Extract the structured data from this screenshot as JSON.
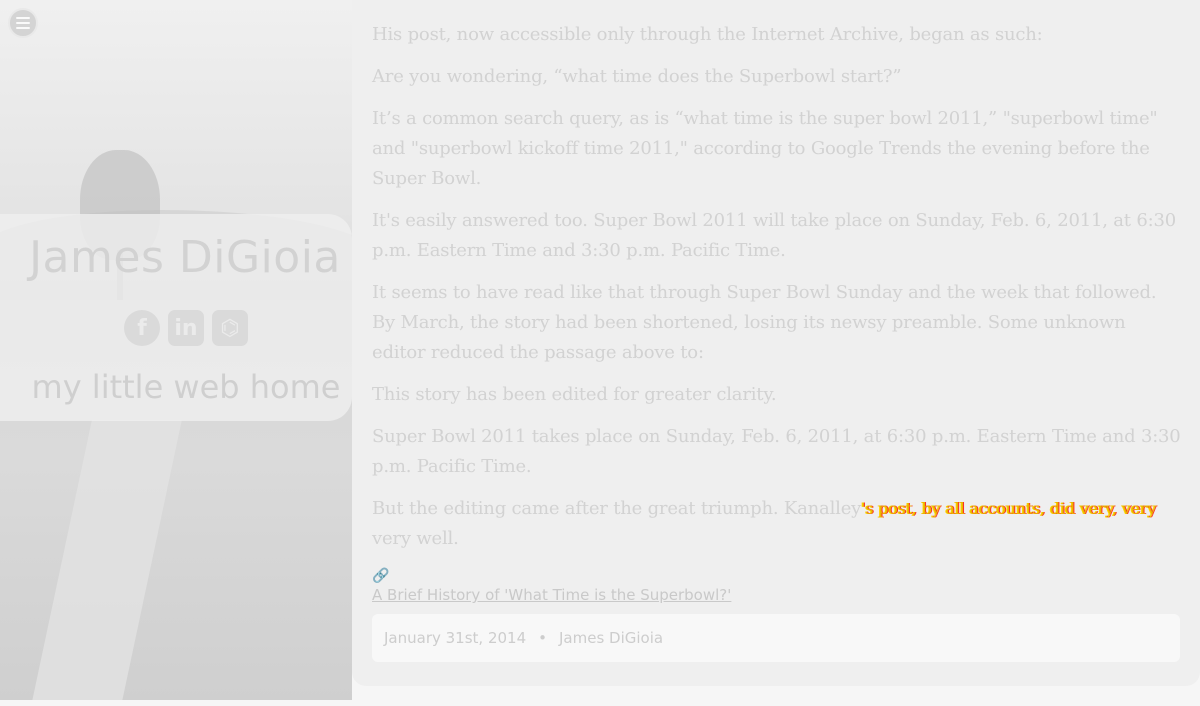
{
  "profile": {
    "name": "James DiGioia",
    "tagline": "my little web home",
    "social": [
      {
        "icon": "facebook-icon",
        "glyph": "f"
      },
      {
        "icon": "linkedin-icon",
        "glyph": "in"
      },
      {
        "icon": "github-icon",
        "glyph": "⌬"
      }
    ]
  },
  "post": {
    "paragraphs": [
      "His post, now accessible only through the Internet Archive, began as such:",
      "Are you wondering, “what time does the Superbowl start?”",
      "It’s a common search query, as is “what time is the super bowl 2011,” \"superbowl time\" and \"superbowl kickoff time 2011,\" according to Google Trends the evening before the Super Bowl.",
      "It's easily answered too. Super Bowl 2011 will take place on Sunday, Feb. 6, 2011, at 6:30 p.m. Eastern Time and 3:30 p.m. Pacific Time.",
      "It seems to have read like that through Super Bowl Sunday and the week that followed. By March, the story had been shortened, losing its newsy preamble. Some unknown editor reduced the passage above to:",
      "This story has been edited for greater clarity.",
      "Super Bowl 2011 takes place on Sunday, Feb. 6, 2011, at 6:30 p.m. Eastern Time and 3:30 p.m. Pacific Time."
    ],
    "last_paragraph_start": "But the editing came after the great triumph. Kanalley",
    "last_paragraph_glitch": "'s post, by all accounts, did very, very",
    "last_paragraph_end": "very well.",
    "permalink_title": "A Brief History of 'What Time is the Superbowl?'",
    "date": "January 31st, 2014",
    "separator": "•",
    "author": "James DiGioia"
  }
}
